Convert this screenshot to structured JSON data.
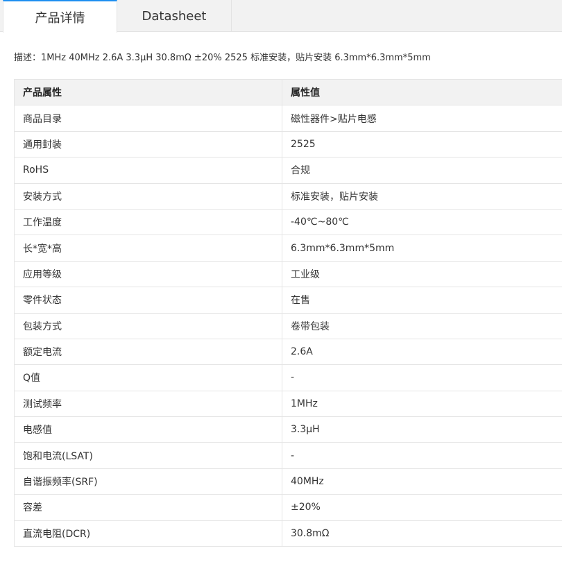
{
  "tabs": [
    {
      "label": "产品详情",
      "active": true
    },
    {
      "label": "Datasheet",
      "active": false
    }
  ],
  "description": "描述：1MHz 40MHz 2.6A 3.3µH 30.8mΩ ±20% 2525 标准安装，贴片安装 6.3mm*6.3mm*5mm",
  "table": {
    "headers": [
      "产品属性",
      "属性值"
    ],
    "rows": [
      [
        "商品目录",
        "磁性器件>贴片电感"
      ],
      [
        "通用封装",
        "2525"
      ],
      [
        "RoHS",
        "合规"
      ],
      [
        "安装方式",
        "标准安装，贴片安装"
      ],
      [
        "工作温度",
        "-40℃~80℃"
      ],
      [
        "长*宽*高",
        "6.3mm*6.3mm*5mm"
      ],
      [
        "应用等级",
        "工业级"
      ],
      [
        "零件状态",
        "在售"
      ],
      [
        "包装方式",
        "卷带包装"
      ],
      [
        "额定电流",
        "2.6A"
      ],
      [
        "Q值",
        "-"
      ],
      [
        "测试频率",
        "1MHz"
      ],
      [
        "电感值",
        "3.3µH"
      ],
      [
        "饱和电流(LSAT)",
        "-"
      ],
      [
        "自谐振频率(SRF)",
        "40MHz"
      ],
      [
        "容差",
        "±20%"
      ],
      [
        "直流电阻(DCR)",
        "30.8mΩ"
      ]
    ]
  },
  "colors": {
    "accent": "#1e8ff0",
    "header_bg": "#f2f2f2",
    "border": "#e5e5e5"
  }
}
